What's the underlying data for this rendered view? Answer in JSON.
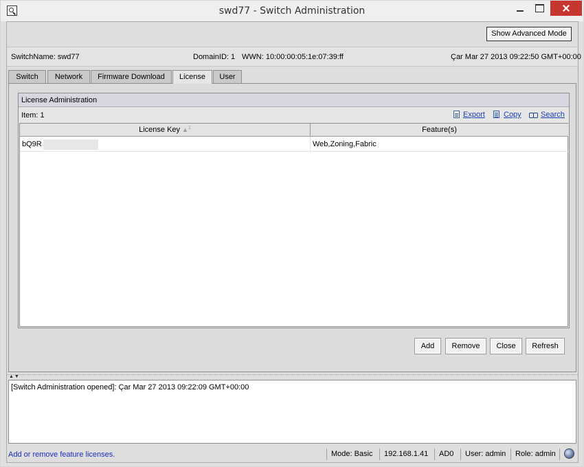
{
  "window": {
    "title": "swd77 - Switch Administration"
  },
  "header": {
    "advanced_mode_label": "Show Advanced Mode"
  },
  "info": {
    "switch_name": "SwitchName: swd77",
    "domain_id": "DomainID: 1",
    "wwn": "WWN: 10:00:00:05:1e:07:39:ff",
    "datetime": "Çar Mar 27 2013 09:22:50 GMT+00:00"
  },
  "tabs": [
    {
      "label": "Switch"
    },
    {
      "label": "Network"
    },
    {
      "label": "Firmware Download"
    },
    {
      "label": "License",
      "active": true
    },
    {
      "label": "User"
    }
  ],
  "license": {
    "panel_title": "License Administration",
    "item_count": "Item: 1",
    "toolbar": {
      "export": "Export",
      "copy": "Copy",
      "search": "Search"
    },
    "columns": {
      "key": "License Key",
      "sort_indicator": "▲",
      "sort_order": "1",
      "features": "Feature(s)"
    },
    "rows": [
      {
        "key": "bQ9R",
        "features": "Web,Zoning,Fabric"
      }
    ]
  },
  "actions": {
    "add": "Add",
    "remove": "Remove",
    "close": "Close",
    "refresh": "Refresh"
  },
  "log": {
    "line": "[Switch Administration opened]: Çar Mar 27 2013 09:22:09 GMT+00:00"
  },
  "status": {
    "message": "Add or remove feature licenses.",
    "mode": "Mode: Basic",
    "ip": "192.168.1.41",
    "ad": "AD0",
    "user": "User: admin",
    "role": "Role: admin"
  },
  "icons": [
    "app-search-icon",
    "minimize-icon",
    "maximize-icon",
    "close-icon",
    "export-icon",
    "copy-icon",
    "search-icon",
    "globe-icon",
    "splitter-arrows-icon"
  ]
}
